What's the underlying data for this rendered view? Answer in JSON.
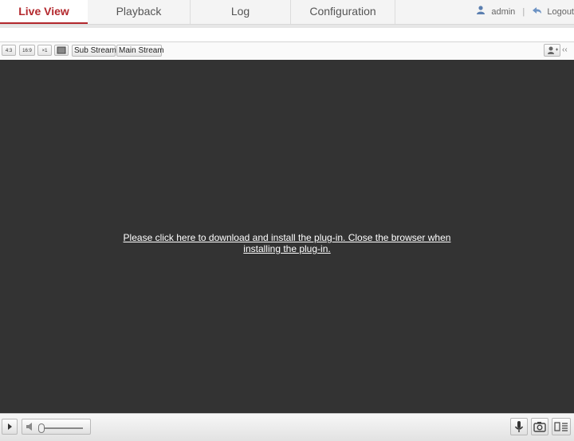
{
  "nav": {
    "tabs": [
      {
        "label": "Live View",
        "active": true
      },
      {
        "label": "Playback",
        "active": false
      },
      {
        "label": "Log",
        "active": false
      },
      {
        "label": "Configuration",
        "active": false
      }
    ],
    "user": {
      "name": "admin",
      "separator": "|",
      "logout_label": "Logout"
    }
  },
  "toolbar": {
    "aspect_4_3": "4:3",
    "aspect_16_9": "16:9",
    "aspect_1_1": "×1",
    "sub_stream_label": "Sub Stream",
    "main_stream_label": "Main Stream"
  },
  "viewer": {
    "plugin_message_line1": "Please click here to download and install the plug-in. Close the browser when",
    "plugin_message_line2": "installing the plug-in."
  },
  "colors": {
    "accent": "#b3282d",
    "viewer_bg": "#333333"
  },
  "icons": [
    "user-icon",
    "logout-icon",
    "ptz-icon",
    "collapse-icon",
    "play-icon",
    "volume-icon",
    "microphone-icon",
    "camera-icon",
    "record-icon",
    "fullscreen-icon"
  ]
}
